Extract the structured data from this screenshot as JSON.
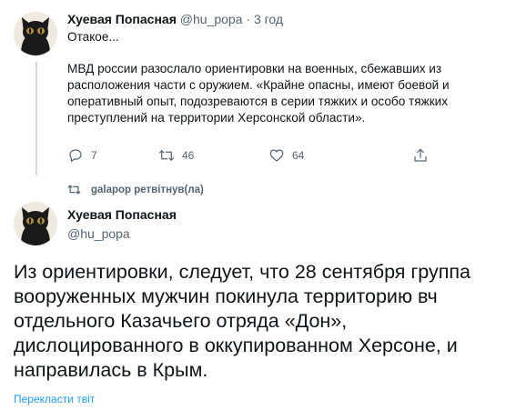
{
  "tweet1": {
    "author_name": "Хуевая Попасная",
    "author_handle": "@hu_popa",
    "separator": "·",
    "time": "3 год",
    "text_line1": "Отакое...",
    "text_paragraph2": "МВД россии разослало ориентировки на военных, сбежавших из расположения части с оружием. «Крайне опасны, имеют боевой и оперативный опыт, подозреваются в серии тяжких и особо тяжких преступлений на территории Херсонской области».",
    "reply_count": "7",
    "retweet_count": "46",
    "like_count": "64"
  },
  "retweet_note": "galapop ретвітнув(ла)",
  "tweet2": {
    "author_name": "Хуевая Попасная",
    "author_handle": "@hu_popa",
    "text": "Из ориентировки, следует, что 28 сентября группа вооруженных мужчин покинула территорию вч отдельного Казачьего отряда «Дон», дислоцированного в оккупированном Херсоне, и направилась в Крым.",
    "translate_link": "Перекласти твіт"
  },
  "colors": {
    "text": "#0f1419",
    "secondary": "#536471",
    "link": "#1d9bf0",
    "divider": "#cfd9de"
  },
  "icons": {
    "reply": "reply-icon",
    "retweet": "retweet-icon",
    "like": "heart-icon",
    "share": "share-icon",
    "avatar": "cat-avatar-icon"
  }
}
